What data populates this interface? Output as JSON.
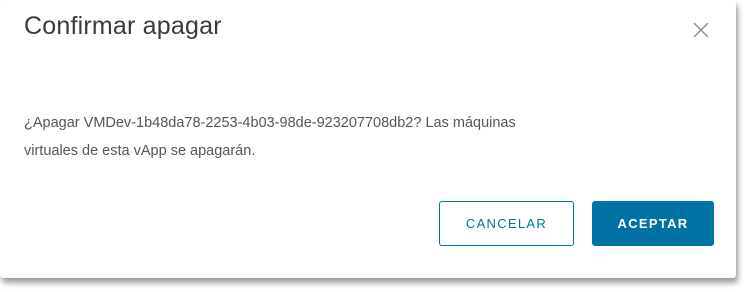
{
  "dialog": {
    "title": "Confirmar apagar",
    "close_icon": "close-icon",
    "message_line1": "¿Apagar VMDev-1b48da78-2253-4b03-98de-923207708db2? Las máquinas",
    "message_line2": "virtuales de esta vApp se apagarán.",
    "cancel_label": "CANCELAR",
    "accept_label": "ACEPTAR"
  },
  "colors": {
    "primary": "#0072a3",
    "title_text": "#3b3b3b",
    "body_text": "#565656",
    "close_icon": "#8c8c8c"
  }
}
